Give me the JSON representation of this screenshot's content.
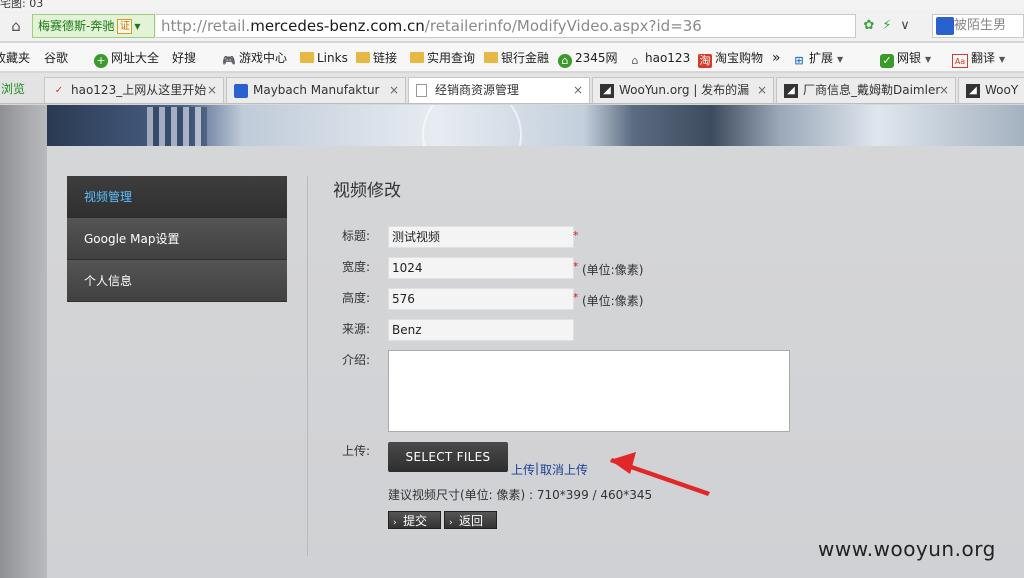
{
  "window": {
    "title": "宅图: 03"
  },
  "addressbar": {
    "ev_label": "梅赛德斯-奔驰",
    "ev_badge": "证",
    "url_prefix": "http://retail.",
    "url_domain": "mercedes-benz.com.cn",
    "url_path": "/retailerinfo/ModifyVideo.aspx?id=36",
    "search_placeholder": "被陌生男"
  },
  "bookmarks": [
    {
      "label": "收藏夹",
      "icon": "none"
    },
    {
      "label": "谷歌",
      "icon": "page"
    },
    {
      "label": "网址大全",
      "icon": "green"
    },
    {
      "label": "好搜",
      "icon": "page"
    },
    {
      "label": "游戏中心",
      "icon": "game"
    },
    {
      "label": "Links",
      "icon": "folder"
    },
    {
      "label": "链接",
      "icon": "folder"
    },
    {
      "label": "实用查询",
      "icon": "folder"
    },
    {
      "label": "银行金融",
      "icon": "folder"
    },
    {
      "label": "2345网",
      "icon": "green"
    },
    {
      "label": "hao123",
      "icon": "gray"
    },
    {
      "label": "淘宝购物",
      "icon": "red"
    },
    {
      "label": "»",
      "icon": "none"
    },
    {
      "label": "扩展",
      "icon": "blue"
    },
    {
      "label": "网银",
      "icon": "shield"
    },
    {
      "label": "翻译",
      "icon": "ad"
    }
  ],
  "tabs": {
    "first": "浏览",
    "items": [
      {
        "label": "hao123_上网从这里开始",
        "active": false
      },
      {
        "label": "Maybach Manufaktur",
        "active": false
      },
      {
        "label": "经销商资源管理",
        "active": true
      },
      {
        "label": "WooYun.org | 发布的漏",
        "active": false
      },
      {
        "label": "厂商信息_戴姆勒Daimler",
        "active": false
      },
      {
        "label": "WooY",
        "active": false
      }
    ]
  },
  "nav": {
    "items": [
      {
        "label": "视频管理",
        "active": true
      },
      {
        "label": "Google Map设置",
        "active": false
      },
      {
        "label": "个人信息",
        "active": false
      }
    ]
  },
  "form": {
    "title": "视频修改",
    "title_label": "标题:",
    "title_value": "测试视频",
    "width_label": "宽度:",
    "width_value": "1024",
    "height_label": "高度:",
    "height_value": "576",
    "source_label": "来源:",
    "source_value": "Benz",
    "intro_label": "介绍:",
    "intro_value": "",
    "upload_label": "上传:",
    "required_mark": "*",
    "unit": "(单位:像素)",
    "select_files": "SELECT FILES",
    "upload_link": "上传",
    "separator": "|",
    "cancel_link": "取消上传",
    "hint": "建议视频尺寸(单位: 像素) : 710*399 / 460*345",
    "submit": "提交",
    "back": "返回"
  },
  "watermark": "www.wooyun.org",
  "colors": {
    "nav_active_text": "#5cc0ff",
    "required": "#d42020",
    "link": "#1c3f95",
    "arrow": "#e02828"
  }
}
